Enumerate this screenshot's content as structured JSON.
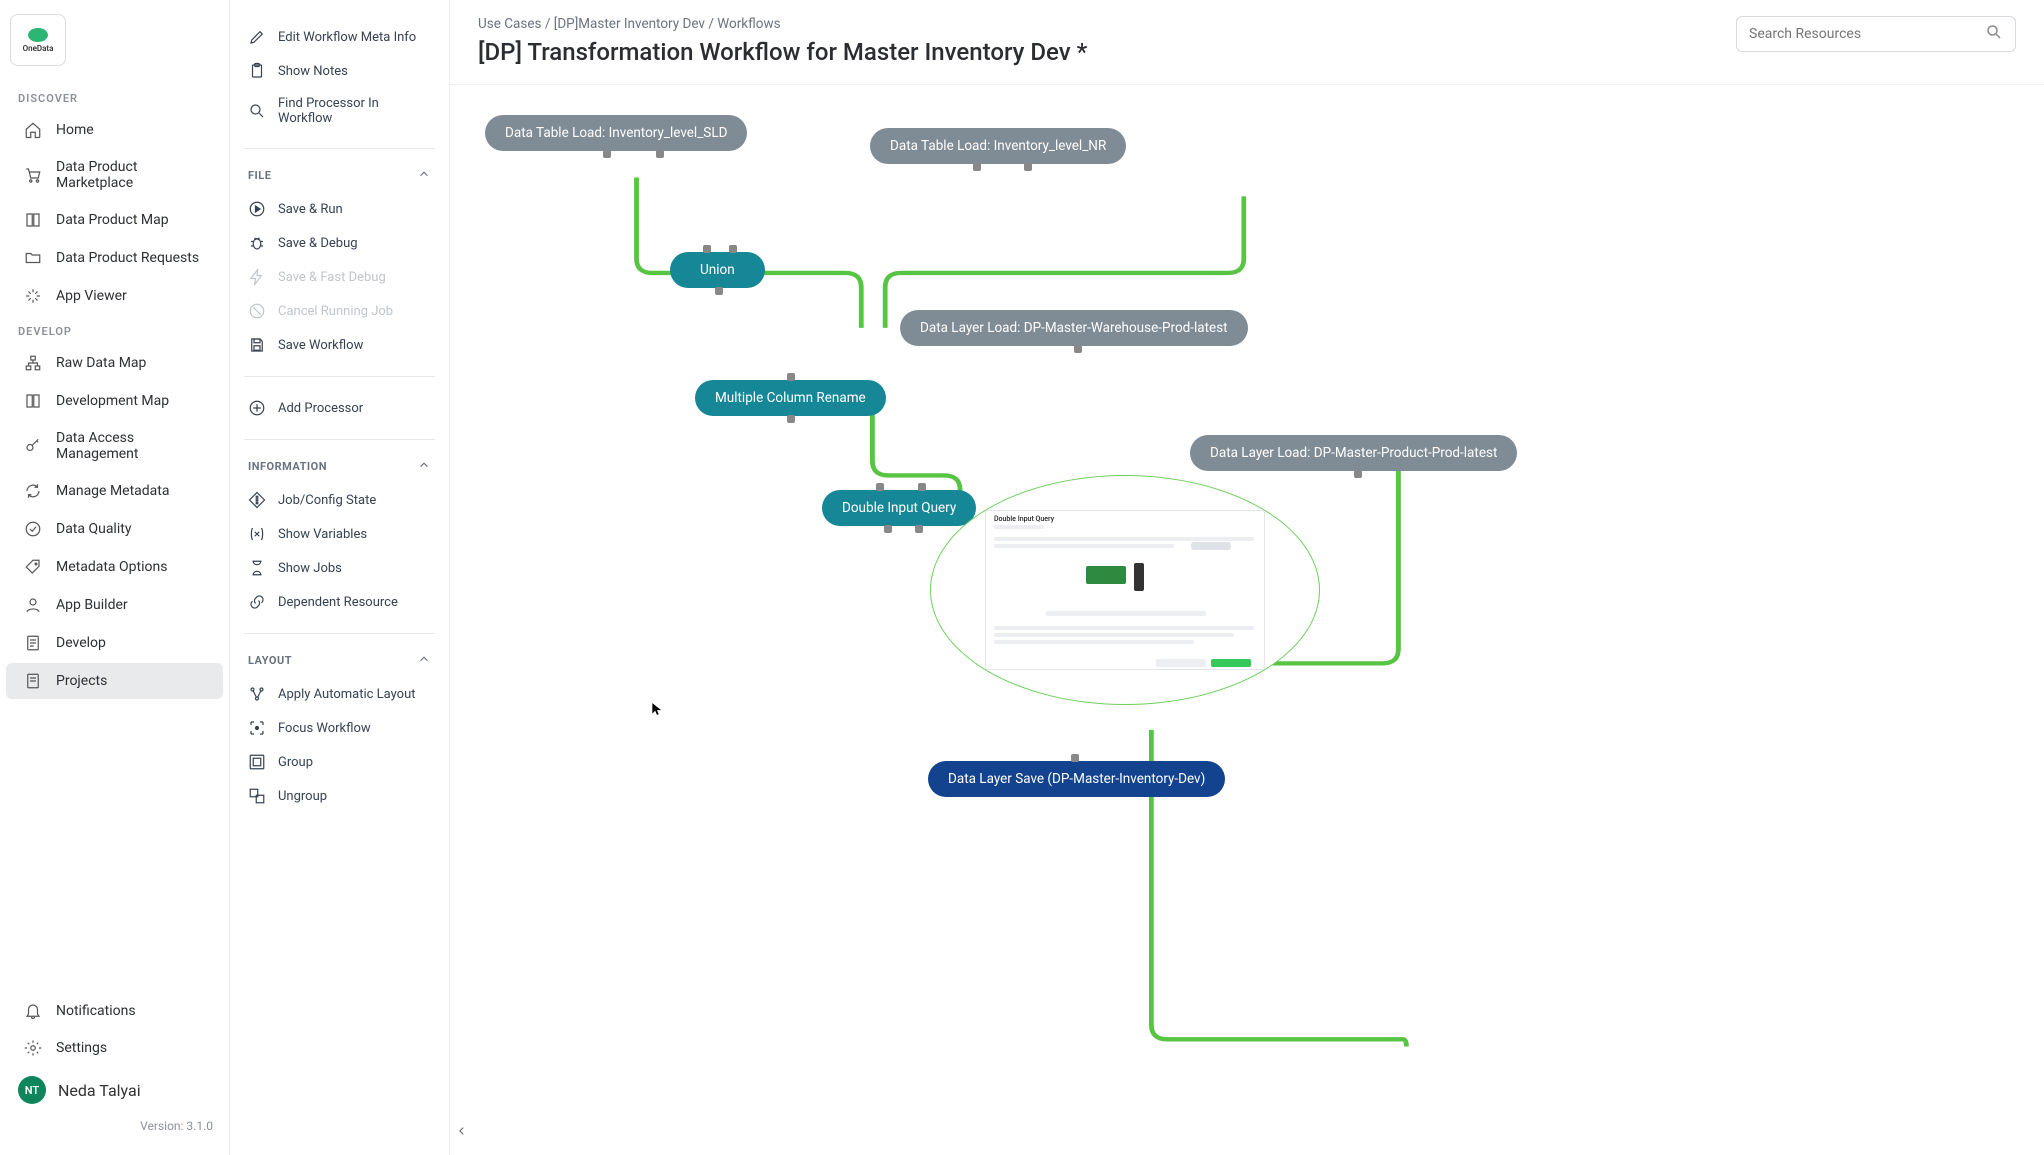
{
  "brand": {
    "name": "OneData"
  },
  "search": {
    "placeholder": "Search Resources"
  },
  "nav": {
    "sections": [
      {
        "header": "DISCOVER",
        "items": [
          {
            "key": "home",
            "label": "Home",
            "icon": "home"
          },
          {
            "key": "marketplace",
            "label": "Data Product Marketplace",
            "icon": "cart"
          },
          {
            "key": "map",
            "label": "Data Product Map",
            "icon": "book"
          },
          {
            "key": "requests",
            "label": "Data Product Requests",
            "icon": "folder"
          },
          {
            "key": "appviewer",
            "label": "App Viewer",
            "icon": "eye"
          }
        ]
      },
      {
        "header": "DEVELOP",
        "items": [
          {
            "key": "rawmap",
            "label": "Raw Data Map",
            "icon": "sitemap"
          },
          {
            "key": "devmap",
            "label": "Development Map",
            "icon": "book"
          },
          {
            "key": "access",
            "label": "Data Access Management",
            "icon": "key"
          },
          {
            "key": "metadata",
            "label": "Manage Metadata",
            "icon": "refresh"
          },
          {
            "key": "quality",
            "label": "Data Quality",
            "icon": "check-circle"
          },
          {
            "key": "metaopt",
            "label": "Metadata Options",
            "icon": "tag"
          },
          {
            "key": "builder",
            "label": "App Builder",
            "icon": "person-edit"
          },
          {
            "key": "develop",
            "label": "Develop",
            "icon": "doc"
          },
          {
            "key": "projects",
            "label": "Projects",
            "icon": "doc",
            "active": true
          }
        ]
      }
    ],
    "footer": {
      "notifications": "Notifications",
      "settings": "Settings",
      "user_initials": "NT",
      "user_name": "Neda Talyai",
      "version": "Version: 3.1.0"
    }
  },
  "toolbar": {
    "top": [
      {
        "label": "Edit Workflow Meta Info",
        "icon": "pencil"
      },
      {
        "label": "Show Notes",
        "icon": "clipboard"
      },
      {
        "label": "Find Processor In Workflow",
        "icon": "search"
      }
    ],
    "file": {
      "header": "FILE",
      "items": [
        {
          "label": "Save & Run",
          "icon": "play-circle"
        },
        {
          "label": "Save & Debug",
          "icon": "bug"
        },
        {
          "label": "Save & Fast Debug",
          "icon": "flash",
          "disabled": true
        },
        {
          "label": "Cancel Running Job",
          "icon": "cancel",
          "disabled": true
        },
        {
          "label": "Save Workflow",
          "icon": "save"
        }
      ]
    },
    "add_processor": "Add Processor",
    "information": {
      "header": "INFORMATION",
      "items": [
        {
          "label": "Job/Config State",
          "icon": "diamond"
        },
        {
          "label": "Show Variables",
          "icon": "var"
        },
        {
          "label": "Show Jobs",
          "icon": "hourglass"
        },
        {
          "label": "Dependent Resource",
          "icon": "link"
        }
      ]
    },
    "layout": {
      "header": "LAYOUT",
      "items": [
        {
          "label": "Apply Automatic Layout",
          "icon": "autolayout"
        },
        {
          "label": "Focus Workflow",
          "icon": "crosshair"
        },
        {
          "label": "Group",
          "icon": "group"
        },
        {
          "label": "Ungroup",
          "icon": "ungroup"
        }
      ]
    }
  },
  "breadcrumb": {
    "parts": [
      "Use Cases",
      "[DP]Master Inventory Dev",
      "Workflows"
    ]
  },
  "title": "[DP] Transformation Workflow for Master Inventory Dev *",
  "nodes": {
    "sld": {
      "label": "Data Table Load: Inventory_level_SLD"
    },
    "nr": {
      "label": "Data Table Load: Inventory_level_NR"
    },
    "union": {
      "label": "Union"
    },
    "warehouse": {
      "label": "Data Layer Load: DP-Master-Warehouse-Prod-latest"
    },
    "rename": {
      "label": "Multiple Column Rename"
    },
    "dquery": {
      "label": "Double Input Query"
    },
    "product": {
      "label": "Data Layer Load: DP-Master-Product-Prod-latest"
    },
    "save": {
      "label": "Data Layer Save (DP-Master-Inventory-Dev)"
    }
  },
  "preview": {
    "title": "Double Input Query"
  }
}
